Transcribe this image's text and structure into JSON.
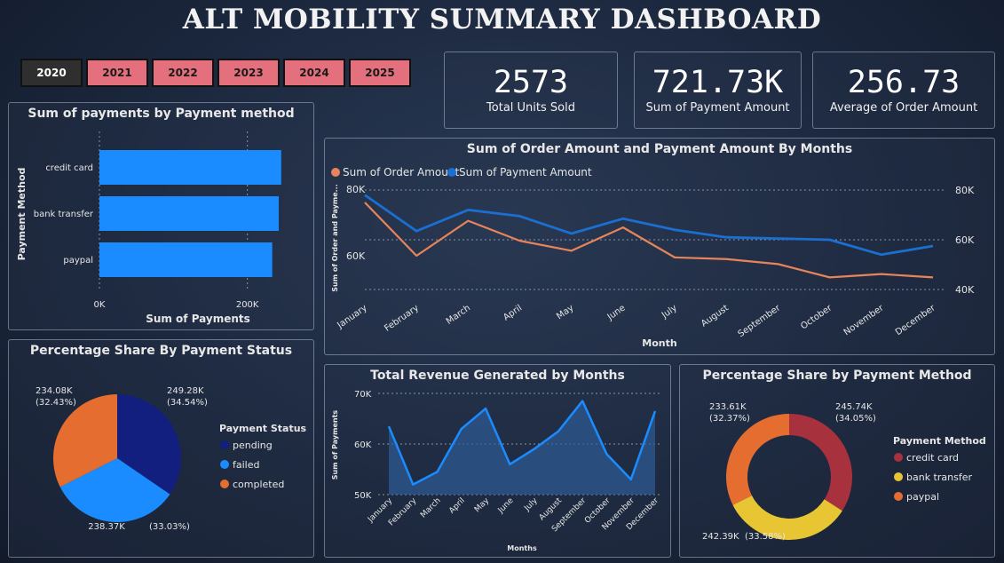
{
  "title": "ALT MOBILITY SUMMARY DASHBOARD",
  "years": [
    {
      "label": "2020",
      "active": true
    },
    {
      "label": "2021",
      "active": false
    },
    {
      "label": "2022",
      "active": false
    },
    {
      "label": "2023",
      "active": false
    },
    {
      "label": "2024",
      "active": false
    },
    {
      "label": "2025",
      "active": false
    }
  ],
  "kpis": [
    {
      "value": "2573",
      "label": "Total Units Sold"
    },
    {
      "value": "721.73K",
      "label": "Sum of Payment Amount"
    },
    {
      "value": "256.73",
      "label": "Average of Order Amount"
    }
  ],
  "colors": {
    "orange": "#e8845a",
    "blue": "#1a6fd1",
    "bar": "#1a8cff",
    "pending": "#121f7e",
    "failed": "#1a8cff",
    "completed": "#e56d2f",
    "credit_card": "#a8313e",
    "bank_transfer": "#e8c532",
    "paypal": "#e56d2f"
  },
  "chart_data": [
    {
      "id": "payments_by_method",
      "type": "bar",
      "orientation": "horizontal",
      "title": "Sum of payments by Payment method",
      "xlabel": "Sum of Payments",
      "ylabel": "Payment Method",
      "categories": [
        "credit card",
        "bank transfer",
        "paypal"
      ],
      "values": [
        245740,
        242390,
        233610
      ],
      "xlim": [
        0,
        300000
      ],
      "xticks": [
        {
          "v": 0,
          "label": "0K"
        },
        {
          "v": 200000,
          "label": "200K"
        }
      ],
      "grid": true
    },
    {
      "id": "order_payment_by_months",
      "type": "line",
      "title": "Sum of Order Amount and Payment Amount By Months",
      "xlabel": "Month",
      "ylabel": "Sum of Order and Payme...",
      "categories": [
        "January",
        "February",
        "March",
        "April",
        "May",
        "June",
        "July",
        "August",
        "September",
        "October",
        "November",
        "December"
      ],
      "series": [
        {
          "name": "Sum of Order Amount",
          "axis": "left",
          "values": [
            76,
            60,
            70.5,
            64.5,
            61.5,
            68.5,
            59.5,
            59,
            57.5,
            53.5,
            54.5,
            53.5
          ]
        },
        {
          "name": "Sum of Payment Amount",
          "axis": "right",
          "values": [
            78,
            63.5,
            72,
            69.5,
            62.5,
            68.5,
            64,
            61,
            60.5,
            60,
            54,
            57.5
          ]
        }
      ],
      "left_ylim": [
        50,
        85
      ],
      "right_ylim": [
        40,
        85
      ],
      "left_yticks": [
        {
          "v": 60,
          "label": "60K"
        },
        {
          "v": 80,
          "label": "80K"
        }
      ],
      "right_yticks": [
        {
          "v": 40,
          "label": "40K"
        },
        {
          "v": 60,
          "label": "60K"
        },
        {
          "v": 80,
          "label": "80K"
        }
      ],
      "legend_position": "top-left"
    },
    {
      "id": "payment_status_share",
      "type": "pie",
      "title": "Percentage Share By Payment Status",
      "legend_title": "Payment Status",
      "slices": [
        {
          "name": "pending",
          "value": 249.28,
          "label": "249.28K",
          "pct": "(34.54%)"
        },
        {
          "name": "failed",
          "value": 238.37,
          "label": "238.37K",
          "pct": "(33.03%)"
        },
        {
          "name": "completed",
          "value": 234.08,
          "label": "234.08K",
          "pct": "(32.43%)"
        }
      ]
    },
    {
      "id": "revenue_by_months",
      "type": "area",
      "title": "Total Revenue Generated by Months",
      "xlabel": "Months",
      "ylabel": "Sum of Payments",
      "categories": [
        "January",
        "February",
        "March",
        "April",
        "May",
        "June",
        "July",
        "August",
        "September",
        "October",
        "November",
        "December"
      ],
      "values": [
        63.5,
        52,
        54.5,
        63,
        67,
        56,
        59,
        62.5,
        68.5,
        58,
        53,
        66.5
      ],
      "ylim": [
        50,
        70
      ],
      "yticks": [
        {
          "v": 50,
          "label": "50K"
        },
        {
          "v": 60,
          "label": "60K"
        },
        {
          "v": 70,
          "label": "70K"
        }
      ]
    },
    {
      "id": "payment_method_share",
      "type": "pie",
      "donut": true,
      "title": "Percentage Share by Payment Method",
      "legend_title": "Payment Method",
      "slices": [
        {
          "name": "credit card",
          "value": 245.74,
          "label": "245.74K",
          "pct": "(34.05%)"
        },
        {
          "name": "bank transfer",
          "value": 242.39,
          "label": "242.39K",
          "pct": "(33.58%)"
        },
        {
          "name": "paypal",
          "value": 233.61,
          "label": "233.61K",
          "pct": "(32.37%)"
        }
      ]
    }
  ]
}
